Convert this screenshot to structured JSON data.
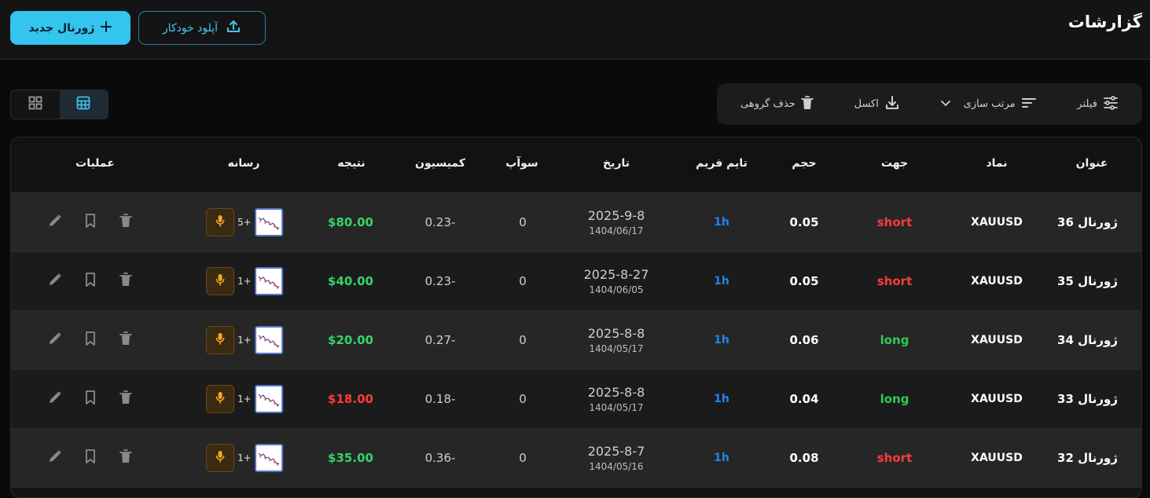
{
  "header": {
    "title": "گزارشات",
    "new_journal_label": "ژورنال جدید",
    "auto_upload_label": "آپلود خودکار"
  },
  "toolbar": {
    "filter_label": "فیلتر",
    "sort_label": "مرتب سازی",
    "excel_label": "اکسل",
    "bulk_delete_label": "حذف گروهی"
  },
  "table": {
    "columns": {
      "title": "عنوان",
      "symbol": "نماد",
      "direction": "جهت",
      "volume": "حجم",
      "timeframe": "تایم فریم",
      "date": "تاریخ",
      "swap": "سوآپ",
      "commission": "کمیسیون",
      "result": "نتیجه",
      "media": "رسانه",
      "actions": "عملیات"
    },
    "rows": [
      {
        "title": "ژورنال 36",
        "symbol": "XAUUSD",
        "direction": "short",
        "volume": "0.05",
        "timeframe": "1h",
        "date": "2025-9-8",
        "date_shamsi": "1404/06/17",
        "swap": "0",
        "commission": "0.23-",
        "result": "$80.00",
        "media_more": "5+"
      },
      {
        "title": "ژورنال 35",
        "symbol": "XAUUSD",
        "direction": "short",
        "volume": "0.05",
        "timeframe": "1h",
        "date": "2025-8-27",
        "date_shamsi": "1404/06/05",
        "swap": "0",
        "commission": "0.23-",
        "result": "$40.00",
        "media_more": "1+"
      },
      {
        "title": "ژورنال 34",
        "symbol": "XAUUSD",
        "direction": "long",
        "volume": "0.06",
        "timeframe": "1h",
        "date": "2025-8-8",
        "date_shamsi": "1404/05/17",
        "swap": "0",
        "commission": "0.27-",
        "result": "$20.00",
        "media_more": "1+"
      },
      {
        "title": "ژورنال 33",
        "symbol": "XAUUSD",
        "direction": "long",
        "volume": "0.04",
        "timeframe": "1h",
        "date": "2025-8-8",
        "date_shamsi": "1404/05/17",
        "swap": "0",
        "commission": "0.18-",
        "result": "$18.00",
        "media_more": "1+"
      },
      {
        "title": "ژورنال 32",
        "symbol": "XAUUSD",
        "direction": "short",
        "volume": "0.08",
        "timeframe": "1h",
        "date": "2025-8-7",
        "date_shamsi": "1404/05/16",
        "swap": "0",
        "commission": "0.36-",
        "result": "$35.00",
        "media_more": "1+"
      }
    ]
  },
  "colors": {
    "accent": "#33c5ee",
    "short": "#ff3b3b",
    "long": "#2ecc55",
    "profit": "#35d36a",
    "loss": "#ff3b3b",
    "timeframe": "#1d86f0",
    "mic": "#f5a623"
  }
}
